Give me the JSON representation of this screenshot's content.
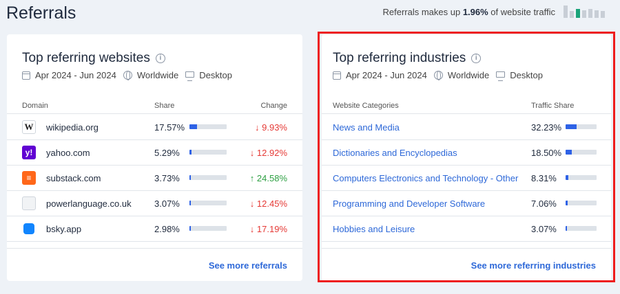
{
  "page": {
    "title": "Referrals"
  },
  "summary": {
    "text_before": "Referrals makes up ",
    "value": "1.96%",
    "text_after": " of website traffic"
  },
  "mini_bars": [
    {
      "level": 1.0,
      "color": "#c8ced6"
    },
    {
      "level": 0.55,
      "color": "#c8ced6"
    },
    {
      "level": 0.7,
      "color": "#1aa37a"
    },
    {
      "level": 0.6,
      "color": "#c8ced6"
    },
    {
      "level": 0.7,
      "color": "#c8ced6"
    },
    {
      "level": 0.6,
      "color": "#c8ced6"
    },
    {
      "level": 0.55,
      "color": "#c8ced6"
    }
  ],
  "websites": {
    "title": "Top referring websites",
    "date_range": "Apr 2024 - Jun 2024",
    "region": "Worldwide",
    "device": "Desktop",
    "headers": {
      "domain": "Domain",
      "share": "Share",
      "change": "Change"
    },
    "rows": [
      {
        "domain": "wikipedia.org",
        "share": "17.57%",
        "share_fraction": 0.1757,
        "change": "9.93%",
        "direction": "down",
        "icon": "wikipedia-icon",
        "icon_glyph": "W",
        "icon_bg": "#ffffff",
        "icon_color": "#222222"
      },
      {
        "domain": "yahoo.com",
        "share": "5.29%",
        "share_fraction": 0.0529,
        "change": "12.92%",
        "direction": "down",
        "icon": "yahoo-icon",
        "icon_glyph": "y!",
        "icon_bg": "#6001d2",
        "icon_color": "#ffffff"
      },
      {
        "domain": "substack.com",
        "share": "3.73%",
        "share_fraction": 0.0373,
        "change": "24.58%",
        "direction": "up",
        "icon": "substack-icon",
        "icon_glyph": "≡",
        "icon_bg": "#ff6719",
        "icon_color": "#ffffff"
      },
      {
        "domain": "powerlanguage.co.uk",
        "share": "3.07%",
        "share_fraction": 0.0307,
        "change": "12.45%",
        "direction": "down",
        "icon": "page-icon",
        "icon_glyph": "",
        "icon_bg": "#f1f3f5",
        "icon_color": "#8a94a3"
      },
      {
        "domain": "bsky.app",
        "share": "2.98%",
        "share_fraction": 0.0298,
        "change": "17.19%",
        "direction": "down",
        "icon": "bluesky-icon",
        "icon_glyph": "",
        "icon_bg": "#1185fe",
        "icon_color": "#ffffff"
      }
    ],
    "more_label": "See more referrals"
  },
  "industries": {
    "title": "Top referring industries",
    "date_range": "Apr 2024 - Jun 2024",
    "region": "Worldwide",
    "device": "Desktop",
    "headers": {
      "category": "Website Categories",
      "share": "Traffic Share"
    },
    "rows": [
      {
        "category": "News and Media",
        "share": "32.23%",
        "share_fraction": 0.3223
      },
      {
        "category": "Dictionaries and Encyclopedias",
        "share": "18.50%",
        "share_fraction": 0.185
      },
      {
        "category": "Computers Electronics and Technology - Other",
        "share": "8.31%",
        "share_fraction": 0.0831
      },
      {
        "category": "Programming and Developer Software",
        "share": "7.06%",
        "share_fraction": 0.0706
      },
      {
        "category": "Hobbies and Leisure",
        "share": "3.07%",
        "share_fraction": 0.0307
      }
    ],
    "more_label": "See more referring industries"
  },
  "colors": {
    "accent": "#2e62e6",
    "link": "#2d68d8",
    "negative": "#e53935",
    "positive": "#2ea043",
    "highlight": "#ee1c1c"
  }
}
